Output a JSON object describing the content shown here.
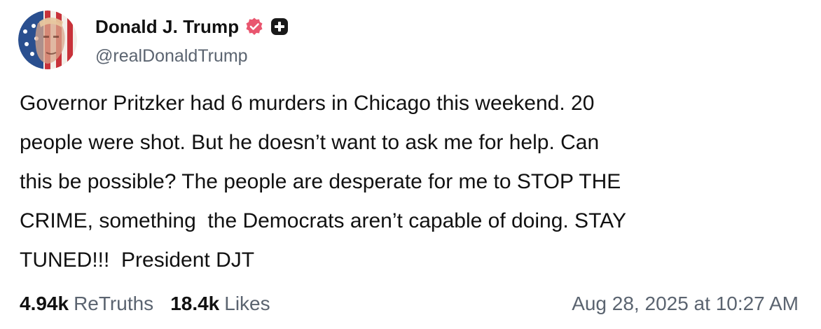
{
  "author": {
    "display_name": "Donald J. Trump",
    "handle": "@realDonaldTrump",
    "verified": true,
    "verified_icon": "verified-badge-icon",
    "plus_icon": "plus-badge-icon"
  },
  "post": {
    "text": "Governor Pritzker had 6 murders in Chicago this weekend. 20\npeople were shot. But he doesn’t want to ask me for help. Can\nthis be possible? The people are desperate for me to STOP THE\nCRIME, something  the Democrats aren’t capable of doing. STAY\nTUNED!!!  President DJT"
  },
  "stats": {
    "retruths_count": "4.94k",
    "retruths_label": "ReTruths",
    "likes_count": "18.4k",
    "likes_label": "Likes"
  },
  "timestamp": "Aug 28, 2025 at 10:27 AM",
  "colors": {
    "text": "#111111",
    "secondary": "#5b6470",
    "verified_badge": "#e9566f",
    "plus_badge": "#1a1a1a"
  }
}
